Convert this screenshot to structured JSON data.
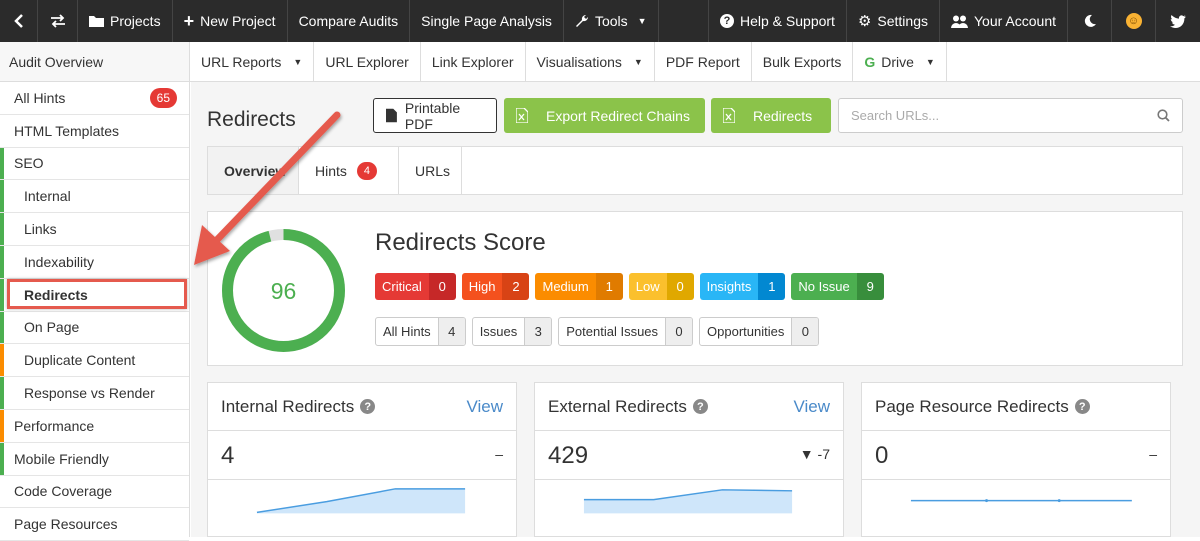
{
  "topbar": {
    "projects": "Projects",
    "new_project": "New Project",
    "compare_audits": "Compare Audits",
    "single_page": "Single Page Analysis",
    "tools": "Tools",
    "help": "Help & Support",
    "settings": "Settings",
    "account": "Your Account"
  },
  "subbar": {
    "audit_overview": "Audit Overview",
    "url_reports": "URL Reports",
    "url_explorer": "URL Explorer",
    "link_explorer": "Link Explorer",
    "visualisations": "Visualisations",
    "pdf_report": "PDF Report",
    "bulk_exports": "Bulk Exports",
    "drive": "Drive"
  },
  "sidebar": {
    "items": [
      {
        "label": "All Hints",
        "badge": "65"
      },
      {
        "label": "HTML Templates"
      },
      {
        "label": "SEO"
      },
      {
        "label": "Internal"
      },
      {
        "label": "Links"
      },
      {
        "label": "Indexability"
      },
      {
        "label": "Redirects"
      },
      {
        "label": "On Page"
      },
      {
        "label": "Duplicate Content"
      },
      {
        "label": "Response vs Render"
      },
      {
        "label": "Performance"
      },
      {
        "label": "Mobile Friendly"
      },
      {
        "label": "Code Coverage"
      },
      {
        "label": "Page Resources"
      }
    ]
  },
  "page": {
    "title": "Redirects",
    "printable_pdf": "Printable PDF",
    "export_chains": "Export Redirect Chains",
    "redirects_btn": "Redirects",
    "search_placeholder": "Search URLs..."
  },
  "tabs": {
    "overview": "Overview",
    "hints": "Hints",
    "hints_badge": "4",
    "urls": "URLs"
  },
  "score": {
    "title": "Redirects Score",
    "value": "96",
    "percent": 96,
    "pills": [
      {
        "label": "Critical",
        "count": "0",
        "color": "#e53935",
        "dark": "#c62828"
      },
      {
        "label": "High",
        "count": "2",
        "color": "#f4511e",
        "dark": "#d84315"
      },
      {
        "label": "Medium",
        "count": "1",
        "color": "#fb8c00",
        "dark": "#e07b00"
      },
      {
        "label": "Low",
        "count": "0",
        "color": "#fbc02d",
        "dark": "#e0a800"
      },
      {
        "label": "Insights",
        "count": "1",
        "color": "#29b6f6",
        "dark": "#0288d1"
      },
      {
        "label": "No Issue",
        "count": "9",
        "color": "#4caf50",
        "dark": "#388e3c"
      }
    ],
    "hints": [
      {
        "label": "All Hints",
        "count": "4"
      },
      {
        "label": "Issues",
        "count": "3"
      },
      {
        "label": "Potential Issues",
        "count": "0"
      },
      {
        "label": "Opportunities",
        "count": "0"
      }
    ]
  },
  "cards": [
    {
      "title": "Internal Redirects",
      "view": "View",
      "value": "4",
      "delta": "–"
    },
    {
      "title": "External Redirects",
      "view": "View",
      "value": "429",
      "delta": "▼ -7"
    },
    {
      "title": "Page Resource Redirects",
      "view": "",
      "value": "0",
      "delta": "–"
    }
  ],
  "colors": {
    "accent_green": "#8bc34a",
    "topbar": "#2b2b2b",
    "link": "#4a8ac9"
  }
}
